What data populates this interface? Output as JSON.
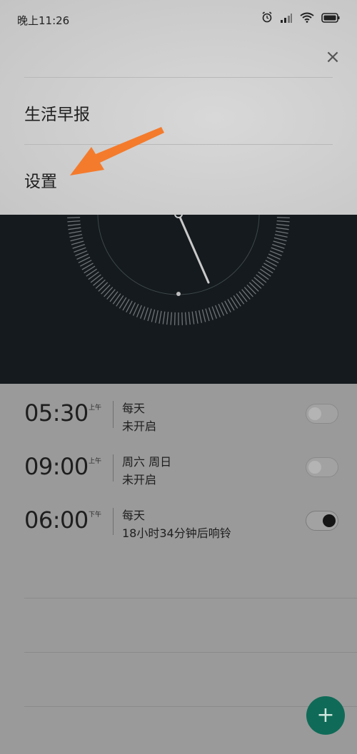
{
  "status_bar": {
    "time": "晚上11:26",
    "icons": [
      "alarm-icon",
      "signal-icon",
      "wifi-icon",
      "battery-icon"
    ]
  },
  "menu": {
    "close_icon": "close-icon",
    "items": [
      {
        "label": "生活早报"
      },
      {
        "label": "设置"
      }
    ]
  },
  "alarms": [
    {
      "time": "05:30",
      "ampm": "上午",
      "repeat": "每天",
      "status": "未开启",
      "enabled": false
    },
    {
      "time": "09:00",
      "ampm": "上午",
      "repeat": "周六 周日",
      "status": "未开启",
      "enabled": false
    },
    {
      "time": "06:00",
      "ampm": "下午",
      "repeat": "每天",
      "status": "18小时34分钟后响铃",
      "enabled": true
    }
  ],
  "fab": {
    "label": "+"
  },
  "colors": {
    "accent_arrow": "#f47b2c",
    "fab": "#0f6b57",
    "clock_bg": "#141a1d"
  }
}
